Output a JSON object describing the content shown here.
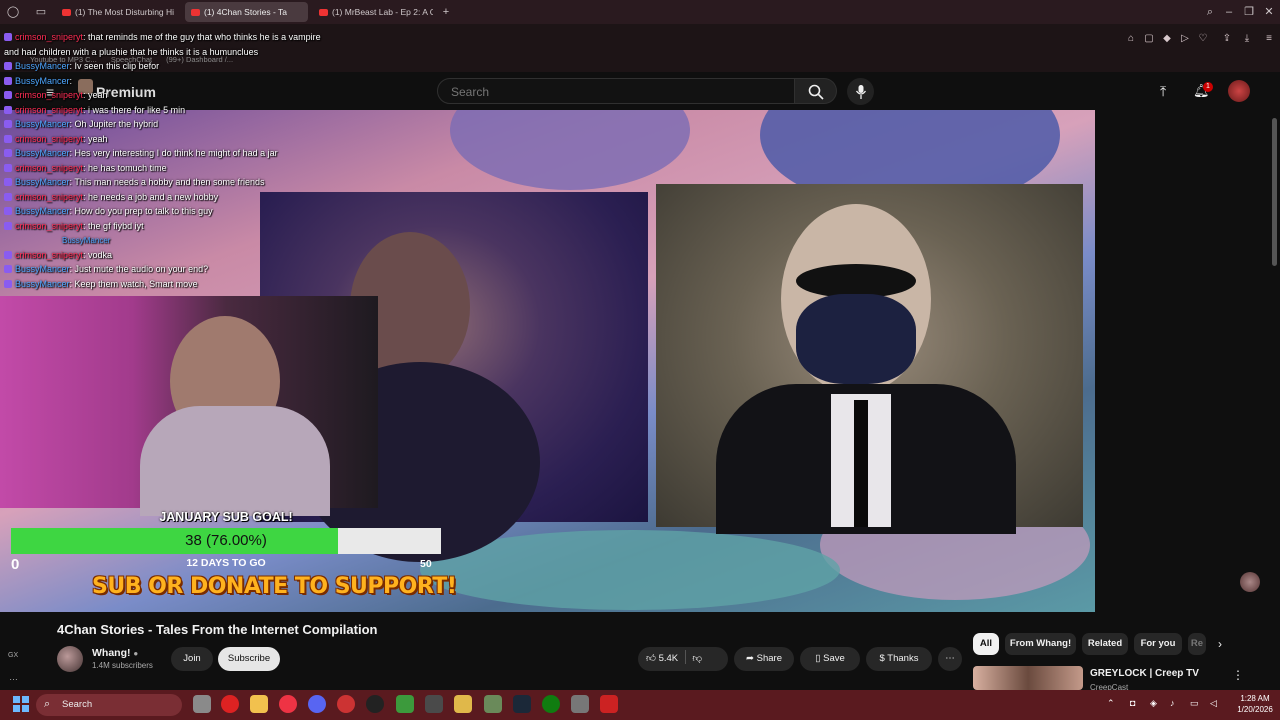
{
  "browser": {
    "tabs": [
      {
        "label": "(1) The Most Disturbing Hi",
        "active": false
      },
      {
        "label": "(1) 4Chan Stories - Ta",
        "active": true
      },
      {
        "label": "(1) MrBeast Lab - Ep 2: A C",
        "active": false
      }
    ],
    "new_tab": "+",
    "bookmarks": [
      "Youtube to MP3 C...",
      "SpeechChat",
      "(99+) Dashboard /..."
    ]
  },
  "youtube": {
    "premium_label": "Premium",
    "search_placeholder": "Search",
    "notification_count": "1"
  },
  "chat": [
    {
      "user": "crimson_sniperyt",
      "color": "crimson",
      "msg": "that reminds me of the guy that who thinks he is a vampire"
    },
    {
      "user": "",
      "color": "none",
      "msg": "and had children with a plushie that he thinks it is a humunclues"
    },
    {
      "user": "BussyMancer",
      "color": "bussy",
      "msg": "Iv seen this clip befor"
    },
    {
      "user": "BussyMancer",
      "color": "bussy",
      "msg": ""
    },
    {
      "user": "crimson_sniperyt",
      "color": "crimson",
      "msg": "yeah"
    },
    {
      "user": "crimson_sniperyt",
      "color": "crimson",
      "msg": "i was there for like 5 min"
    },
    {
      "user": "BussyMancer",
      "color": "bussy",
      "msg": "Oh Jupiter the hybrid"
    },
    {
      "user": "crimson_sniperyt",
      "color": "crimson",
      "msg": "yeah"
    },
    {
      "user": "BussyMancer",
      "color": "bussy",
      "msg": "Hes very interesting I do think he might of had a jar"
    },
    {
      "user": "crimson_sniperyt",
      "color": "crimson",
      "msg": "he has tomuch time"
    },
    {
      "user": "BussyMancer",
      "color": "bussy",
      "msg": "This man needs a hobby and then some friends"
    },
    {
      "user": "crimson_sniperyt",
      "color": "crimson",
      "msg": "he needs a job and a new hobby"
    },
    {
      "user": "BussyMancer",
      "color": "bussy",
      "msg": "How do you prep to talk to this guy"
    },
    {
      "user": "crimson_sniperyt",
      "color": "crimson",
      "msg": "the gf fiybd iyt"
    },
    {
      "user": "BussyMancer",
      "color": "reply",
      "msg": ""
    },
    {
      "user": "crimson_sniperyt",
      "color": "crimson",
      "msg": "vodka"
    },
    {
      "user": "BussyMancer",
      "color": "bussy",
      "msg": "Just mute the audio on your end?"
    },
    {
      "user": "BussyMancer",
      "color": "bussy",
      "msg": "Keep them watch, Smart move"
    }
  ],
  "overlay": {
    "goal_title": "JANUARY SUB GOAL!",
    "goal_text": "38 (76.00%)",
    "goal_fraction": 0.76,
    "goal_min": "0",
    "goal_max": "50",
    "days_left": "12 DAYS TO GO",
    "support_text": "SUB OR DONATE TO SUPPORT!"
  },
  "video": {
    "title": "4Chan Stories - Tales From the Internet Compilation",
    "channel": "Whang!",
    "subscribers": "1.4M subscribers",
    "join_label": "Join",
    "subscribe_label": "Subscribe",
    "likes": "5.4K",
    "share_label": "Share",
    "save_label": "Save",
    "thanks_label": "Thanks"
  },
  "chips": [
    "All",
    "From Whang!",
    "Related",
    "For you",
    "Re"
  ],
  "recommendation": {
    "title": "GREYLOCK | Creep TV",
    "channel": "CreepCast"
  },
  "taskbar": {
    "search_placeholder": "Search",
    "time": "1:28 AM",
    "date": "1/20/2026"
  },
  "side_label": "GX",
  "colors": {
    "accent_red": "#ff0000",
    "goal_green": "#3ed642",
    "support_orange": "#ffb21e"
  }
}
